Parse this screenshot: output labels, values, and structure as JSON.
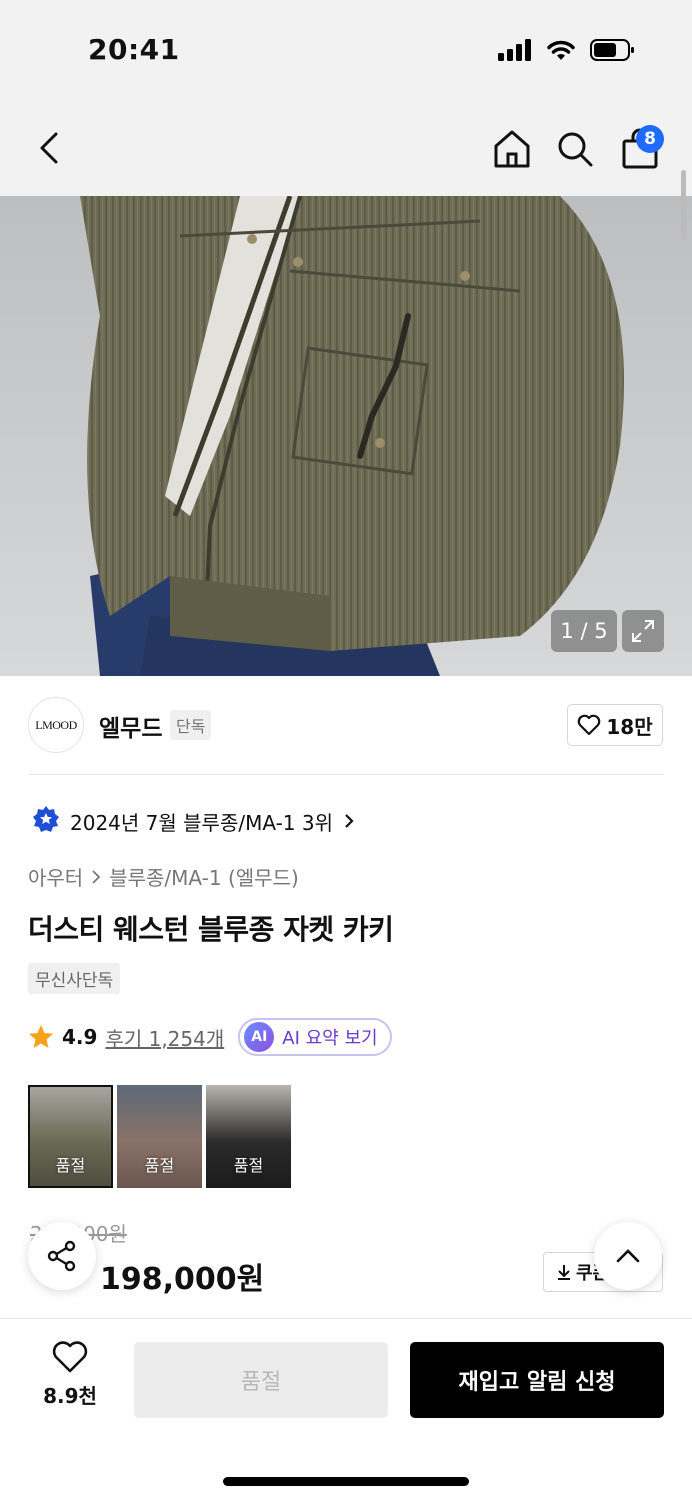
{
  "status": {
    "time": "20:41"
  },
  "nav": {
    "cart_count": "8"
  },
  "gallery": {
    "counter": "1 / 5"
  },
  "brand": {
    "logo_text": "LMOOD",
    "name": "엘무드",
    "tag": "단독",
    "likes": "18만"
  },
  "ranking": {
    "text": "2024년 7월 블루종/MA-1 3위"
  },
  "breadcrumb": {
    "category": "아우터",
    "subcategory": "블루종/MA-1 (엘무드)"
  },
  "product": {
    "title": "더스티 웨스턴 블루종 자켓 카키",
    "exclusive_badge": "무신사단독",
    "rating": "4.9",
    "reviews": "후기 1,254개",
    "ai_label": "AI",
    "ai_summary": "AI 요약 보기"
  },
  "variants": [
    {
      "label": "품절",
      "color": "#6b6a55"
    },
    {
      "label": "품절",
      "color": "#8a7268"
    },
    {
      "label": "품절",
      "color": "#2b2b2b"
    }
  ],
  "price": {
    "original": "2??,000원",
    "sale": "198,000원",
    "coupon": "쿠폰"
  },
  "bottom": {
    "wish_count": "8.9천",
    "soldout": "품절",
    "restock": "재입고 알림 신청"
  },
  "colors": {
    "accent_blue": "#1f6bff",
    "discount_red": "#ff3b30",
    "ai_purple": "#6a3bd0"
  }
}
